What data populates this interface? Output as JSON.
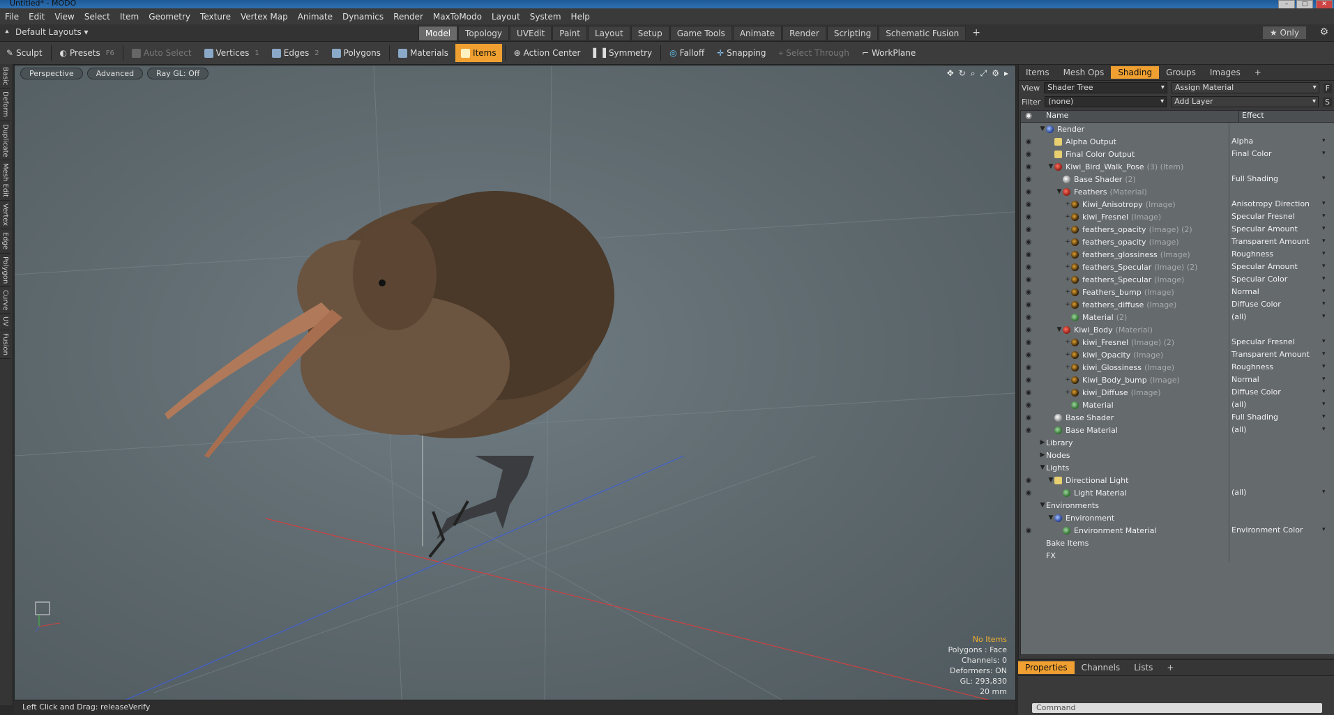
{
  "window": {
    "title": "Untitled* - MODO"
  },
  "menu": [
    "File",
    "Edit",
    "View",
    "Select",
    "Item",
    "Geometry",
    "Texture",
    "Vertex Map",
    "Animate",
    "Dynamics",
    "Render",
    "MaxToModo",
    "Layout",
    "System",
    "Help"
  ],
  "layout": {
    "default_layouts": "Default Layouts",
    "tabs": [
      "Model",
      "Topology",
      "UVEdit",
      "Paint",
      "Layout",
      "Setup",
      "Game Tools",
      "Animate",
      "Render",
      "Scripting",
      "Schematic Fusion"
    ],
    "active_tab": "Model",
    "plus": "+",
    "only": "Only"
  },
  "toolbar": {
    "sculpt": "Sculpt",
    "presets": "Presets",
    "presets_key": "F6",
    "auto_select": "Auto Select",
    "vertices": "Vertices",
    "vertices_num": "1",
    "edges": "Edges",
    "edges_num": "2",
    "polygons": "Polygons",
    "materials": "Materials",
    "items": "Items",
    "action_center": "Action Center",
    "symmetry": "Symmetry",
    "falloff": "Falloff",
    "snapping": "Snapping",
    "select_through": "Select Through",
    "workplane": "WorkPlane"
  },
  "left_tabs": [
    "Basic",
    "Deform",
    "Duplicate",
    "Mesh Edit",
    "Vertex",
    "Edge",
    "Polygon",
    "Curve",
    "UV",
    "Fusion"
  ],
  "viewport": {
    "perspective": "Perspective",
    "advanced": "Advanced",
    "raygl": "Ray GL: Off",
    "info": {
      "no_items": "No Items",
      "polygons": "Polygons : Face",
      "channels": "Channels: 0",
      "deformers": "Deformers: ON",
      "gl": "GL: 293,830",
      "scale": "20 mm"
    }
  },
  "status": "Left Click and Drag:  releaseVerify",
  "panel": {
    "tabs": [
      "Items",
      "Mesh Ops",
      "Shading",
      "Groups",
      "Images"
    ],
    "active_tab": "Shading",
    "view_label": "View",
    "view_value": "Shader Tree",
    "assign": "Assign Material",
    "filter_label": "Filter",
    "filter_value": "(none)",
    "add_layer": "Add Layer",
    "col_name": "Name",
    "col_effect": "Effect",
    "f_button": "F",
    "s_button": "S"
  },
  "tree": [
    {
      "indent": 0,
      "exp": "▼",
      "icon": "blu",
      "name": "Render",
      "sub": "",
      "effect": "",
      "eye": false
    },
    {
      "indent": 1,
      "exp": "",
      "icon": "yel",
      "name": "Alpha Output",
      "sub": "",
      "effect": "Alpha",
      "eye": true
    },
    {
      "indent": 1,
      "exp": "",
      "icon": "yel",
      "name": "Final Color Output",
      "sub": "",
      "effect": "Final Color",
      "eye": true
    },
    {
      "indent": 1,
      "exp": "▼",
      "icon": "red",
      "name": "Kiwi_Bird_Walk_Pose",
      "sub": "(3) (Item)",
      "effect": "",
      "eye": true
    },
    {
      "indent": 2,
      "exp": "",
      "icon": "gry",
      "name": "Base Shader",
      "sub": "(2)",
      "effect": "Full Shading",
      "eye": true
    },
    {
      "indent": 2,
      "exp": "▼",
      "icon": "red",
      "name": "Feathers",
      "sub": "(Material)",
      "effect": "",
      "eye": true
    },
    {
      "indent": 3,
      "exp": "+",
      "icon": "img",
      "name": "Kiwi_Anisotropy",
      "sub": "(Image)",
      "effect": "Anisotropy Direction",
      "eye": true
    },
    {
      "indent": 3,
      "exp": "+",
      "icon": "img",
      "name": "kiwi_Fresnel",
      "sub": "(Image)",
      "effect": "Specular Fresnel",
      "eye": true
    },
    {
      "indent": 3,
      "exp": "+",
      "icon": "img",
      "name": "feathers_opacity",
      "sub": "(Image) (2)",
      "effect": "Specular Amount",
      "eye": true
    },
    {
      "indent": 3,
      "exp": "+",
      "icon": "img",
      "name": "feathers_opacity",
      "sub": "(Image)",
      "effect": "Transparent Amount",
      "eye": true
    },
    {
      "indent": 3,
      "exp": "+",
      "icon": "img",
      "name": "feathers_glossiness",
      "sub": "(Image)",
      "effect": "Roughness",
      "eye": true
    },
    {
      "indent": 3,
      "exp": "+",
      "icon": "img",
      "name": "feathers_Specular",
      "sub": "(Image) (2)",
      "effect": "Specular Amount",
      "eye": true
    },
    {
      "indent": 3,
      "exp": "+",
      "icon": "img",
      "name": "feathers_Specular",
      "sub": "(Image)",
      "effect": "Specular Color",
      "eye": true
    },
    {
      "indent": 3,
      "exp": "+",
      "icon": "img",
      "name": "Feathers_bump",
      "sub": "(Image)",
      "effect": "Normal",
      "eye": true
    },
    {
      "indent": 3,
      "exp": "+",
      "icon": "img",
      "name": "feathers_diffuse",
      "sub": "(Image)",
      "effect": "Diffuse Color",
      "eye": true
    },
    {
      "indent": 3,
      "exp": "",
      "icon": "mat",
      "name": "Material",
      "sub": "(2)",
      "effect": "(all)",
      "eye": true
    },
    {
      "indent": 2,
      "exp": "▼",
      "icon": "red",
      "name": "Kiwi_Body",
      "sub": "(Material)",
      "effect": "",
      "eye": true
    },
    {
      "indent": 3,
      "exp": "+",
      "icon": "img",
      "name": "kiwi_Fresnel",
      "sub": "(Image) (2)",
      "effect": "Specular Fresnel",
      "eye": true
    },
    {
      "indent": 3,
      "exp": "+",
      "icon": "img",
      "name": "kiwi_Opacity",
      "sub": "(Image)",
      "effect": "Transparent Amount",
      "eye": true
    },
    {
      "indent": 3,
      "exp": "+",
      "icon": "img",
      "name": "kiwi_Glossiness",
      "sub": "(Image)",
      "effect": "Roughness",
      "eye": true
    },
    {
      "indent": 3,
      "exp": "+",
      "icon": "img",
      "name": "Kiwi_Body_bump",
      "sub": "(Image)",
      "effect": "Normal",
      "eye": true
    },
    {
      "indent": 3,
      "exp": "+",
      "icon": "img",
      "name": "kiwi_Diffuse",
      "sub": "(Image)",
      "effect": "Diffuse Color",
      "eye": true
    },
    {
      "indent": 3,
      "exp": "",
      "icon": "mat",
      "name": "Material",
      "sub": "",
      "effect": "(all)",
      "eye": true
    },
    {
      "indent": 1,
      "exp": "",
      "icon": "gry",
      "name": "Base Shader",
      "sub": "",
      "effect": "Full Shading",
      "eye": true
    },
    {
      "indent": 1,
      "exp": "",
      "icon": "mat",
      "name": "Base Material",
      "sub": "",
      "effect": "(all)",
      "eye": true
    },
    {
      "indent": 0,
      "exp": "▶",
      "icon": "",
      "name": "Library",
      "sub": "",
      "effect": "",
      "eye": false
    },
    {
      "indent": 0,
      "exp": "▶",
      "icon": "",
      "name": "Nodes",
      "sub": "",
      "effect": "",
      "eye": false
    },
    {
      "indent": 0,
      "exp": "▼",
      "icon": "",
      "name": "Lights",
      "sub": "",
      "effect": "",
      "eye": false
    },
    {
      "indent": 1,
      "exp": "▼",
      "icon": "yel",
      "name": "Directional Light",
      "sub": "",
      "effect": "",
      "eye": true
    },
    {
      "indent": 2,
      "exp": "",
      "icon": "mat",
      "name": "Light Material",
      "sub": "",
      "effect": "(all)",
      "eye": true
    },
    {
      "indent": 0,
      "exp": "▼",
      "icon": "",
      "name": "Environments",
      "sub": "",
      "effect": "",
      "eye": false
    },
    {
      "indent": 1,
      "exp": "▼",
      "icon": "blu",
      "name": "Environment",
      "sub": "",
      "effect": "",
      "eye": false
    },
    {
      "indent": 2,
      "exp": "",
      "icon": "mat",
      "name": "Environment Material",
      "sub": "",
      "effect": "Environment Color",
      "eye": true
    },
    {
      "indent": 0,
      "exp": "",
      "icon": "",
      "name": "Bake Items",
      "sub": "",
      "effect": "",
      "eye": false
    },
    {
      "indent": 0,
      "exp": "",
      "icon": "",
      "name": "FX",
      "sub": "",
      "effect": "",
      "eye": false
    }
  ],
  "bottom_panel": {
    "tabs": [
      "Properties",
      "Channels",
      "Lists"
    ],
    "active_tab": "Properties",
    "command_placeholder": "Command"
  },
  "colors": {
    "accent": "#f0a030",
    "viewport_bg": "#5d686d",
    "grid_x": "#d04040",
    "grid_z": "#4060d0"
  }
}
